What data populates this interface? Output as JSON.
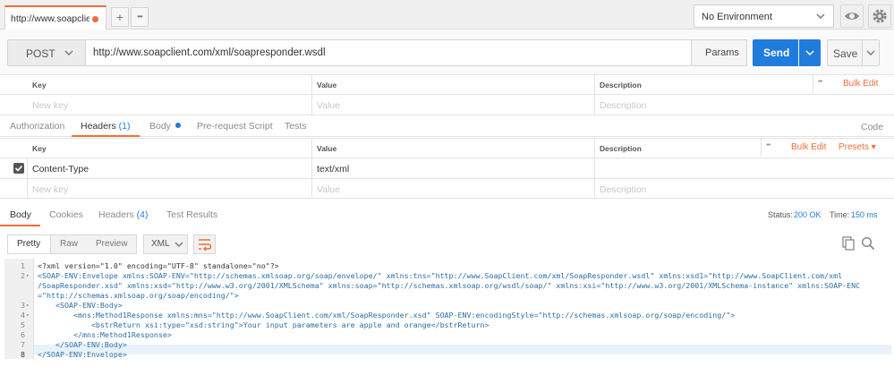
{
  "tabs": {
    "active_tab": "http://www.soapclient",
    "add": "+",
    "more": "•••"
  },
  "environment": {
    "selected": "No Environment"
  },
  "request": {
    "method": "POST",
    "url": "http://www.soapclient.com/xml/soapresponder.wsdl",
    "params_label": "Params",
    "send_label": "Send",
    "save_label": "Save"
  },
  "params_table": {
    "headers": [
      "Key",
      "Value",
      "Description"
    ],
    "more": "•••",
    "bulk_edit": "Bulk Edit",
    "placeholders": {
      "key": "New key",
      "value": "Value",
      "description": "Description"
    }
  },
  "request_tabs": [
    {
      "label": "Authorization"
    },
    {
      "label": "Headers",
      "count": "(1)"
    },
    {
      "label": "Body"
    },
    {
      "label": "Pre-request Script"
    },
    {
      "label": "Tests"
    }
  ],
  "code_link": "Code",
  "headers_table": {
    "headers": [
      "Key",
      "Value",
      "Description"
    ],
    "more": "•••",
    "bulk_edit": "Bulk Edit",
    "presets": "Presets ▾",
    "rows": [
      {
        "key": "Content-Type",
        "value": "text/xml",
        "checked": true
      }
    ],
    "placeholders": {
      "key": "New key",
      "value": "Value",
      "description": "Description"
    }
  },
  "response_tabs": [
    {
      "label": "Body"
    },
    {
      "label": "Cookies"
    },
    {
      "label": "Headers",
      "count": "(4)"
    },
    {
      "label": "Test Results"
    }
  ],
  "status": {
    "label": "Status:",
    "value": "200 OK",
    "time_label": "Time:",
    "time_value": "150 ms"
  },
  "response_toolbar": {
    "pretty": "Pretty",
    "raw": "Raw",
    "preview": "Preview",
    "format": "XML"
  },
  "code_lines": [
    {
      "n": "1",
      "text": "<?xml version=\"1.0\" encoding=\"UTF-8\" standalone=\"no\"?>"
    },
    {
      "n": "2",
      "text": "<SOAP-ENV:Envelope xmlns:SOAP-ENV=\"http://schemas.xmlsoap.org/soap/envelope/\" xmlns:tns=\"http://www.SoapClient.com/xml/SoapResponder.wsdl\" xmlns:xsd1=\"http://www.SoapClient.com/xml"
    },
    {
      "n": "",
      "text": "/SoapResponder.xsd\" xmlns:xsd=\"http://www.w3.org/2001/XMLSchema\" xmlns:soap=\"http://schemas.xmlsoap.org/wsdl/soap/\" xmlns:xsi=\"http://www.w3.org/2001/XMLSchema-instance\" xmlns:SOAP-ENC"
    },
    {
      "n": "",
      "text": "=\"http://schemas.xmlsoap.org/soap/encoding/\">"
    },
    {
      "n": "3",
      "text": "    <SOAP-ENV:Body>"
    },
    {
      "n": "4",
      "text": "        <mns:Method1Response xmlns:mns=\"http://www.SoapClient.com/xml/SoapResponder.xsd\" SOAP-ENV:encodingStyle=\"http://schemas.xmlsoap.org/soap/encoding/\">"
    },
    {
      "n": "5",
      "text": "            <bstrReturn xsi:type=\"xsd:string\">Your input parameters are apple and orange</bstrReturn>"
    },
    {
      "n": "6",
      "text": "        </mns:Method1Response>"
    },
    {
      "n": "7",
      "text": "    </SOAP-ENV:Body>"
    },
    {
      "n": "8",
      "text": "</SOAP-ENV:Envelope>"
    }
  ],
  "colors": {
    "accent": "#1f7bdc",
    "orange": "#ef6d35",
    "status_ok": "#1f7bdc"
  },
  "icons": [
    "chevron-down-icon",
    "eye-icon",
    "gear-icon",
    "checkbox-icon",
    "wrap-lines-icon",
    "copy-icon",
    "search-icon"
  ]
}
